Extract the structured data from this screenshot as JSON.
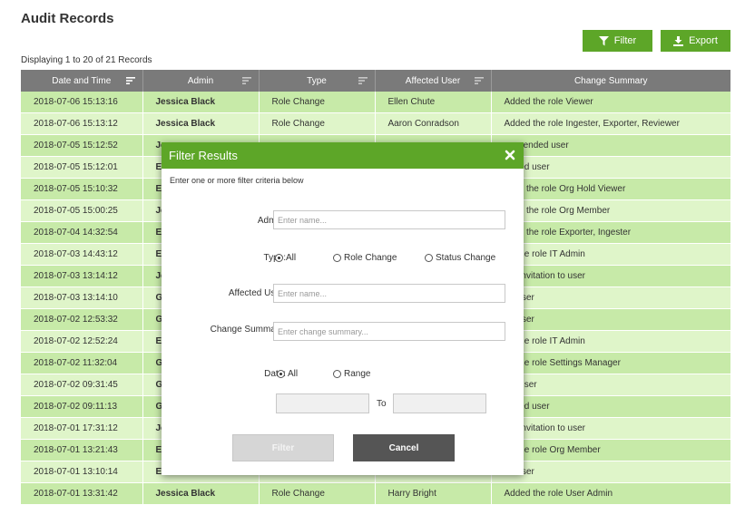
{
  "page": {
    "title": "Audit Records",
    "filter_label": "Filter",
    "export_label": "Export",
    "record_count": "Displaying 1 to 20 of 21 Records"
  },
  "colors": {
    "accent": "#5da628",
    "row_odd": "#c7eaa8",
    "row_even": "#dff5c9",
    "header": "#7a7a7a"
  },
  "table": {
    "columns": [
      "Date and Time",
      "Admin",
      "Type",
      "Affected User",
      "Change Summary"
    ],
    "rows": [
      [
        "2018-07-06 15:13:16",
        "Jessica Black",
        "Role Change",
        "Ellen Chute",
        "Added the role Viewer"
      ],
      [
        "2018-07-06 15:13:12",
        "Jessica Black",
        "Role Change",
        "Aaron Conradson",
        "Added the role Ingester, Exporter, Reviewer"
      ],
      [
        "2018-07-05 15:12:52",
        "Je",
        "",
        "",
        "suspended user"
      ],
      [
        "2018-07-05 15:12:01",
        "E",
        "",
        "",
        "ended user"
      ],
      [
        "2018-07-05 15:10:32",
        "E",
        "",
        "",
        "oved the role Org Hold Viewer"
      ],
      [
        "2018-07-05 15:00:25",
        "Je",
        "",
        "",
        "oved the role Org Member"
      ],
      [
        "2018-07-04 14:32:54",
        "E",
        "",
        "",
        "oved the role Exporter, Ingester"
      ],
      [
        "2018-07-03 14:43:12",
        "E",
        "",
        "",
        "ed the role IT Admin"
      ],
      [
        "2018-07-03 13:14:12",
        "Je",
        "",
        "",
        "ent invitation to user"
      ],
      [
        "2018-07-03 13:14:10",
        "G",
        "",
        "",
        "ed user"
      ],
      [
        "2018-07-02 12:53:32",
        "G",
        "",
        "",
        "ed user"
      ],
      [
        "2018-07-02 12:52:24",
        "E",
        "",
        "",
        "ed the role IT Admin"
      ],
      [
        "2018-07-02 11:32:04",
        "G",
        "",
        "",
        "ed the role Settings Manager"
      ],
      [
        "2018-07-02 09:31:45",
        "G",
        "",
        "",
        "ted user"
      ],
      [
        "2018-07-02 09:11:13",
        "G",
        "",
        "",
        "ended user"
      ],
      [
        "2018-07-01 17:31:12",
        "Je",
        "",
        "",
        "ent invitation to user"
      ],
      [
        "2018-07-01 13:21:43",
        "E",
        "",
        "",
        "ed the role Org Member"
      ],
      [
        "2018-07-01 13:10:14",
        "E",
        "",
        "",
        "ed user"
      ],
      [
        "2018-07-01 13:31:42",
        "Jessica Black",
        "Role Change",
        "Harry Bright",
        "Added the role User Admin"
      ]
    ]
  },
  "modal": {
    "title": "Filter Results",
    "subtitle": "Enter one or more filter criteria below",
    "admin_label": "Admin:",
    "admin_placeholder": "Enter name...",
    "type_label": "Type:",
    "type_options": [
      "All",
      "Role Change",
      "Status Change"
    ],
    "type_selected": "All",
    "affected_label": "Affected User:",
    "affected_placeholder": "Enter name...",
    "summary_label": "Change Summary:",
    "summary_placeholder": "Enter change summary...",
    "date_label": "Date:",
    "date_options": [
      "All",
      "Range"
    ],
    "date_selected": "All",
    "to_label": "To",
    "filter_button": "Filter",
    "cancel_button": "Cancel"
  }
}
